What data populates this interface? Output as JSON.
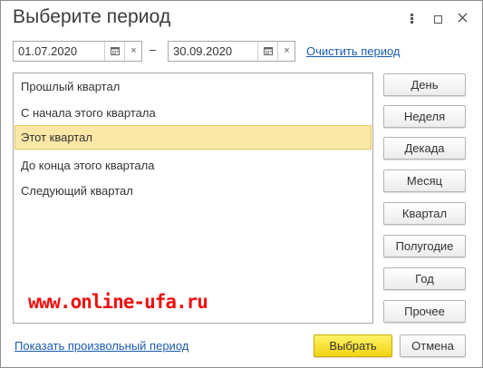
{
  "window": {
    "title": "Выберите период",
    "more_icon": "more-vertical-icon",
    "maximize_icon": "maximize-icon",
    "close_icon": "close-icon"
  },
  "period": {
    "start_date": "01.07.2020",
    "end_date": "30.09.2020",
    "separator": "–",
    "calendar_icon": "calendar-icon",
    "clear_symbol": "×",
    "clear_period_link": "Очистить период"
  },
  "presets": [
    {
      "label": "Прошлый квартал",
      "selected": false
    },
    {
      "label": "С начала этого квартала",
      "selected": false
    },
    {
      "label": "Этот квартал",
      "selected": true
    },
    {
      "label": "До конца этого квартала",
      "selected": false
    },
    {
      "label": "Следующий квартал",
      "selected": false
    }
  ],
  "period_buttons": {
    "day": "День",
    "week": "Неделя",
    "decade": "Декада",
    "month": "Месяц",
    "quarter": "Квартал",
    "half_year": "Полугодие",
    "year": "Год",
    "other": "Прочее"
  },
  "watermark": "www.online-ufa.ru",
  "footer": {
    "show_custom_link": "Показать произвольный период",
    "select_button": "Выбрать",
    "cancel_button": "Отмена"
  },
  "colors": {
    "selected_row": "#fbe8a7",
    "primary_button": "#f2d413",
    "link": "#1a5bb0",
    "watermark": "#ee1111"
  }
}
